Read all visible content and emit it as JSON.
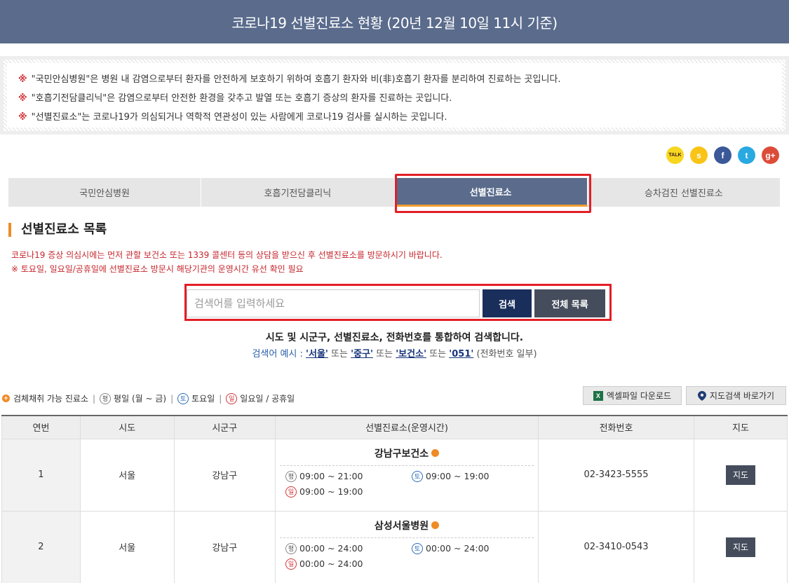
{
  "header": {
    "title": "코로나19 선별진료소 현황 (20년 12월 10일 11시 기준)"
  },
  "notice": {
    "mark": "※",
    "lines": [
      "\"국민안심병원\"은 병원 내 감염으로부터 환자를 안전하게 보호하기 위하여 호흡기 환자와 비(非)호흡기 환자를 분리하여 진료하는 곳입니다.",
      "\"호흡기전담클리닉\"은 감염으로부터 안전한 환경을 갖추고 발열 또는 호흡기 증상의 환자를 진료하는 곳입니다.",
      "\"선별진료소\"는 코로나19가 의심되거나 역학적 연관성이 있는 사람에게 코로나19 검사를 실시하는 곳입니다."
    ]
  },
  "sns": [
    {
      "icon": "kakaotalk-icon",
      "color": "#f7d61f",
      "glyph": "TALK"
    },
    {
      "icon": "kakaostory-icon",
      "color": "#f9c416",
      "glyph": "s"
    },
    {
      "icon": "facebook-icon",
      "color": "#3b5998",
      "glyph": "f"
    },
    {
      "icon": "twitter-icon",
      "color": "#29a9e1",
      "glyph": "t"
    },
    {
      "icon": "googleplus-icon",
      "color": "#dd4b39",
      "glyph": "g+"
    }
  ],
  "tabs": [
    {
      "label": "국민안심병원"
    },
    {
      "label": "호흡기전담클리닉"
    },
    {
      "label": "선별진료소",
      "active": true
    },
    {
      "label": "승차검진 선별진료소"
    }
  ],
  "section": {
    "title": "선별진료소 목록",
    "warn1": "코로나19 증상 의심시에는 먼저 관할 보건소 또는 1339 콜센터 등의 상담을 받으신 후 선별진료소를 방문하시기 바랍니다.",
    "warn2": "※ 토요일, 일요일/공휴일에 선별진료소 방문시 해당기관의 운영시간 유선 확인 필요"
  },
  "search": {
    "placeholder": "검색어를 입력하세요",
    "search_label": "검색",
    "all_label": "전체 목록",
    "desc": "시도 및 시군구, 선별진료소, 전화번호를 통합하여 검색합니다.",
    "ex_prefix": "검색어 예시 : ",
    "ex1": "'서울'",
    "ex2": "'중구'",
    "ex3": "'보건소'",
    "ex4": "'051'",
    "or": "또는",
    "ex_suffix": "(전화번호 일부)"
  },
  "legend": {
    "sample": "검체채취 가능 진료소",
    "weekday_badge": "평",
    "weekday": "평일 (월 ~ 금)",
    "sat_badge": "토",
    "sat": "토요일",
    "sun_badge": "일",
    "sun": "일요일 / 공휴일",
    "sep": "|"
  },
  "buttons": {
    "excel": "엑셀파일 다운로드",
    "map": "지도검색 바로가기",
    "map_small": "지도"
  },
  "table": {
    "headers": [
      "연번",
      "시도",
      "시군구",
      "선별진료소(운영시간)",
      "전화번호",
      "지도"
    ],
    "rows": [
      {
        "no": "1",
        "sido": "서울",
        "sigungu": "강남구",
        "name": "강남구보건소",
        "weekday": "09:00 ~ 21:00",
        "sat": "09:00 ~ 19:00",
        "sun": "09:00 ~ 19:00",
        "phone": "02-3423-5555"
      },
      {
        "no": "2",
        "sido": "서울",
        "sigungu": "강남구",
        "name": "삼성서울병원",
        "weekday": "00:00 ~ 24:00",
        "sat": "00:00 ~ 24:00",
        "sun": "00:00 ~ 24:00",
        "phone": "02-3410-0543"
      }
    ]
  }
}
